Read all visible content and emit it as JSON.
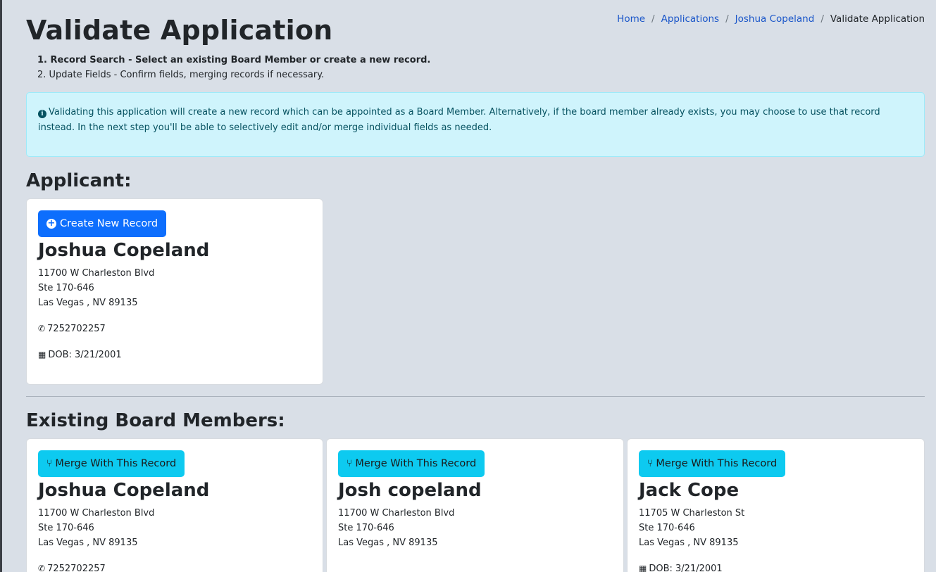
{
  "breadcrumb": {
    "home": "Home",
    "applications": "Applications",
    "applicant": "Joshua Copeland",
    "current": "Validate Application",
    "separator": "/"
  },
  "page_title": "Validate Application",
  "steps": [
    "1. Record Search - Select an existing Board Member or create a new record.",
    "2. Update Fields - Confirm fields, merging records if necessary."
  ],
  "alert": {
    "icon": "info-circle-icon",
    "text": "Validating this application will create a new record which can be appointed as a Board Member. Alternatively, if the board member already exists, you may choose to use that record instead. In the next step you'll be able to selectively edit and/or merge individual fields as needed."
  },
  "applicant_heading": "Applicant:",
  "applicant": {
    "button_label": "Create New Record",
    "name": "Joshua Copeland",
    "address1": "11700 W Charleston Blvd",
    "address2": "Ste 170-646",
    "city_line": "Las Vegas , NV 89135",
    "phone": "7252702257",
    "dob": "DOB: 3/21/2001"
  },
  "existing_heading": "Existing Board Members:",
  "existing": {
    "button_label": "Merge With This Record",
    "members": [
      {
        "name": "Joshua Copeland",
        "address1": "11700 W Charleston Blvd",
        "address2": "Ste 170-646",
        "city_line": "Las Vegas , NV 89135",
        "phone": "7252702257"
      },
      {
        "name": "Josh copeland",
        "address1": "11700 W Charleston Blvd",
        "address2": "Ste 170-646",
        "city_line": "Las Vegas , NV 89135"
      },
      {
        "name": "Jack Cope",
        "address1": "11705 W Charleston St",
        "address2": "Ste 170-646",
        "city_line": "Las Vegas , NV 89135",
        "dob": "DOB: 3/21/2001"
      }
    ]
  },
  "colors": {
    "background": "#d9dfe7",
    "primary": "#0d6efd",
    "info": "#0dcaf0",
    "alert_bg": "#cff4fc",
    "link": "#1a56c9"
  }
}
